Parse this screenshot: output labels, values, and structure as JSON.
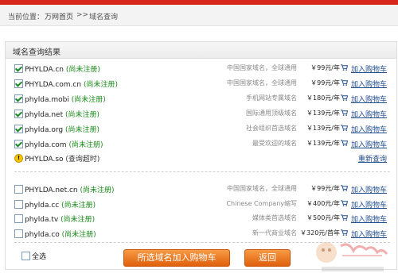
{
  "breadcrumb": {
    "prefix": "当前位置：",
    "home": "万网首页",
    "sep": ">>",
    "current": "域名查询"
  },
  "panel": {
    "title": "域名查询结果"
  },
  "rows_available": [
    {
      "domain": "PHYLDA.cn",
      "status": "(尚未注册)",
      "desc": "中国国家域名，全球通用",
      "price": "￥99元/年",
      "cart": "加入购物车",
      "checked": true
    },
    {
      "domain": "PHYLDA.com.cn",
      "status": "(尚未注册)",
      "desc": "中国国家域名，全球通用",
      "price": "￥99元/年",
      "cart": "加入购物车",
      "checked": true
    },
    {
      "domain": "phylda.mobi",
      "status": "(尚未注册)",
      "desc": "手机网站专属域名",
      "price": "￥180元/年",
      "cart": "加入购物车",
      "checked": true
    },
    {
      "domain": "phylda.net",
      "status": "(尚未注册)",
      "desc": "国际通用顶级域名",
      "price": "￥139元/年",
      "cart": "加入购物车",
      "checked": true
    },
    {
      "domain": "phylda.org",
      "status": "(尚未注册)",
      "desc": "社会组织首选域名",
      "price": "￥139元/年",
      "cart": "加入购物车",
      "checked": true
    },
    {
      "domain": "phylda.com",
      "status": "(尚未注册)",
      "desc": "最受欢迎的域名",
      "price": "￥139元/年",
      "cart": "加入购物车",
      "checked": true
    }
  ],
  "timeout_row": {
    "domain": "PHYLDA.so",
    "status": "(查询超时)",
    "action": "重新查询"
  },
  "rows_more": [
    {
      "domain": "PHYLDA.net.cn",
      "status": "(尚未注册)",
      "desc": "中国国家域名，全球通用",
      "price": "￥99元/年",
      "cart": "加入购物车",
      "checked": false
    },
    {
      "domain": "phylda.cc",
      "status": "(尚未注册)",
      "desc": "Chinese Company缩写",
      "price": "￥400元/年",
      "cart": "加入购物车",
      "checked": false
    },
    {
      "domain": "phylda.tv",
      "status": "(尚未注册)",
      "desc": "媒体类首选域名",
      "price": "￥500元/年",
      "cart": "加入购物车",
      "checked": false
    },
    {
      "domain": "phylda.co",
      "status": "(尚未注册)",
      "desc": "新一代商业域名",
      "price": "￥320元/首年",
      "cart": "加入购物车",
      "checked": false
    }
  ],
  "footer": {
    "select_all": "全选",
    "add_selected": "所选域名加入购物车",
    "back": "返回"
  },
  "colors": {
    "accent": "#d8261b",
    "button": "#e0600c",
    "link": "#1f4c8f",
    "status": "#1a8a1a"
  },
  "icons": [
    "check-icon",
    "warning-icon",
    "cart-icon"
  ]
}
